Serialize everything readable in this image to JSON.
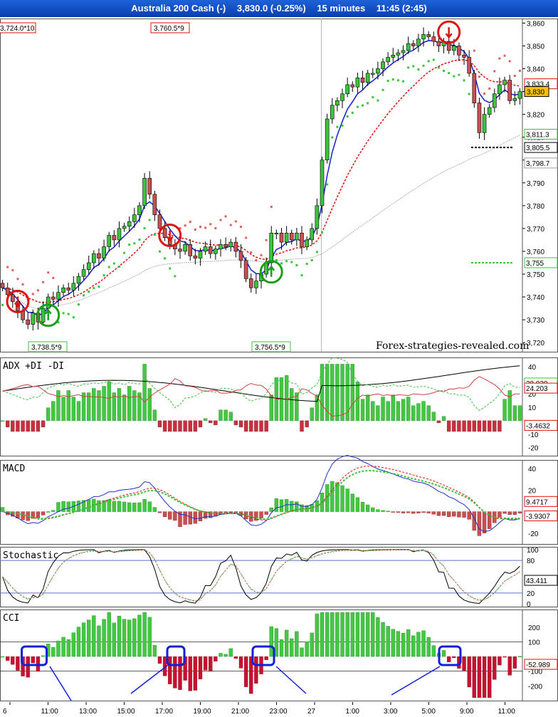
{
  "window": {
    "symbol": "Australia 200 Cash (-)",
    "price": "3,830.0 (-0.25%)",
    "timeframe": "15 minutes",
    "time": "11:45 (2:45)"
  },
  "watermark": "Forex-strategies-revealed.com",
  "colors": {
    "bull": "#3cc43c",
    "bear": "#c85050",
    "ema_fast": "#1020c8",
    "ema_slow": "#e01010",
    "sar_bull": "#3cc43c",
    "sar_bear": "#e06060",
    "sma_long": "#b0b0b0",
    "circle_sell": "#e01010",
    "circle_buy": "#18a018",
    "cci_highlight": "#1020d8"
  },
  "chart_data": [
    {
      "name": "price",
      "type": "candlestick",
      "y_axis_ticks": [
        "3,860",
        "3,850",
        "3,840",
        "3,830",
        "3,820",
        "3,810",
        "3,800",
        "3,790",
        "3,780",
        "3,770",
        "3,760",
        "3,750",
        "3,740",
        "3,730",
        "3,720"
      ],
      "ylim": [
        3716,
        3862
      ],
      "x_axis_ticks": [
        "6",
        "11:00",
        "13:00",
        "15:00",
        "17:00",
        "19:00",
        "21:00",
        "23:00",
        "27",
        "1:00",
        "3:00",
        "5:00",
        "9:00",
        "11:00"
      ],
      "candle_close": [
        3744,
        3741,
        3738,
        3734,
        3730,
        3728,
        3733,
        3729,
        3735,
        3740,
        3739,
        3742,
        3744,
        3743,
        3746,
        3749,
        3752,
        3755,
        3759,
        3757,
        3762,
        3767,
        3765,
        3770,
        3771,
        3773,
        3776,
        3780,
        3792,
        3785,
        3776,
        3770,
        3766,
        3763,
        3761,
        3760,
        3763,
        3758,
        3757,
        3760,
        3762,
        3759,
        3761,
        3763,
        3762,
        3764,
        3760,
        3756,
        3748,
        3744,
        3747,
        3750,
        3755,
        3768,
        3768,
        3764,
        3768,
        3765,
        3768,
        3762,
        3765,
        3770,
        3780,
        3800,
        3818,
        3824,
        3826,
        3829,
        3833,
        3832,
        3836,
        3834,
        3838,
        3838,
        3840,
        3843,
        3845,
        3846,
        3847,
        3848,
        3851,
        3850,
        3853,
        3855,
        3854,
        3852,
        3850,
        3852,
        3848,
        3850,
        3846,
        3845,
        3838,
        3825,
        3812,
        3820,
        3823,
        3829,
        3833,
        3835,
        3826,
        3827,
        3830
      ],
      "last_price": "3,830",
      "price_labels": [
        {
          "text": "3,811.3",
          "value": 3811.3,
          "color": "#3cc43c"
        },
        {
          "text": "3,805.5",
          "value": 3805.5,
          "color": "#000000"
        },
        {
          "text": "3,798.7",
          "value": 3798.7,
          "color": "#a0a0a0"
        },
        {
          "text": "3,755",
          "value": 3755,
          "color": "#3cc43c"
        },
        {
          "text": "3,833.4",
          "value": 3833.4,
          "color": "#e01010"
        }
      ],
      "annotations": [
        "3,724.0*10",
        "3,760.5*9",
        "3,738.5*9",
        "3,756.5*9"
      ],
      "signals": [
        {
          "type": "sell",
          "bar": 3,
          "price": 3738
        },
        {
          "type": "buy",
          "bar": 9,
          "price": 3732
        },
        {
          "type": "sell",
          "bar": 33,
          "price": 3767
        },
        {
          "type": "buy",
          "bar": 53,
          "price": 3751
        },
        {
          "type": "sell",
          "bar": 88,
          "price": 3856
        }
      ]
    },
    {
      "name": "adx",
      "type": "bar+line",
      "title": "ADX  +DI  -DI",
      "y_axis_ticks": [
        "40",
        "20",
        "10",
        "-10",
        "-20"
      ],
      "values_labels": [
        "28.039",
        "24.203",
        "-3.4632"
      ]
    },
    {
      "name": "macd",
      "type": "bar+line",
      "title": "MACD",
      "y_axis_ticks": [
        "40",
        "20",
        "-20"
      ],
      "values_labels": [
        "9.4717",
        "-3.9307"
      ]
    },
    {
      "name": "stochastic",
      "type": "line",
      "title": "Stochastic",
      "y_axis_ticks": [
        "100",
        "80",
        "20",
        "0"
      ],
      "values_labels": [
        "43.411"
      ]
    },
    {
      "name": "cci",
      "type": "bar",
      "title": "CCI",
      "y_axis_ticks": [
        "200",
        "100",
        "-100",
        "-200"
      ],
      "values_labels": [
        "-52.989"
      ]
    }
  ]
}
